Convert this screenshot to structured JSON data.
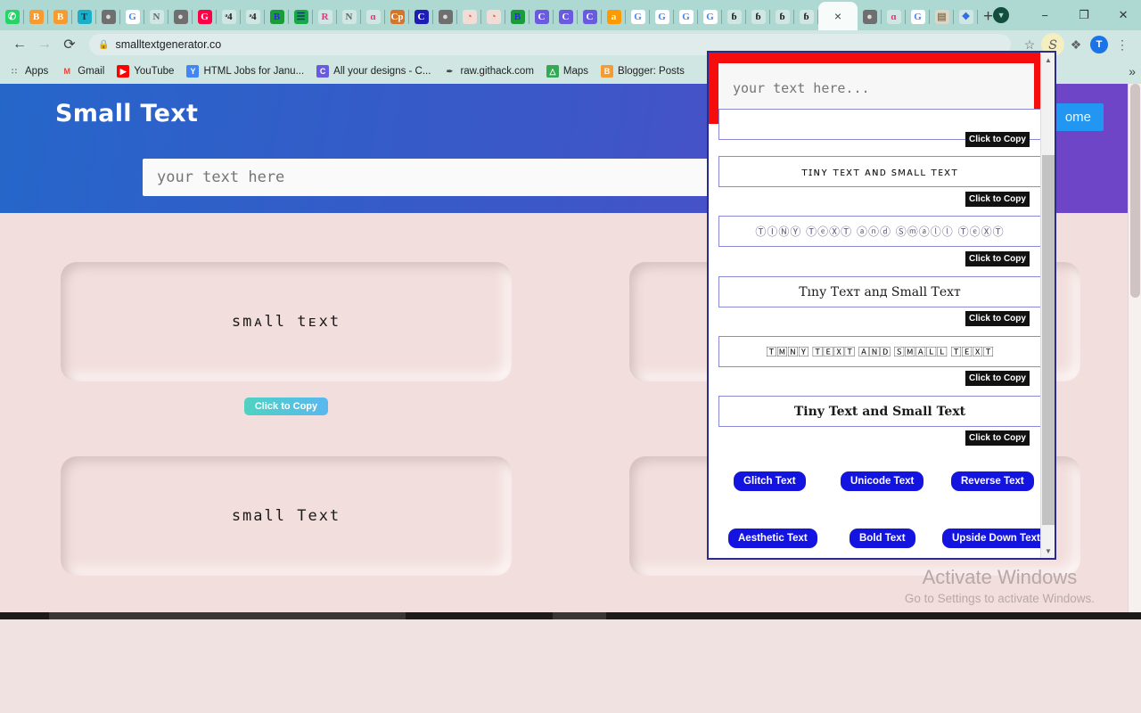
{
  "browser": {
    "tabs": [
      {
        "name": "whatsapp-tab",
        "glyph": "✆",
        "bg": "#25d366",
        "fg": "#ffffff"
      },
      {
        "name": "blogger-tab-1",
        "glyph": "B",
        "bg": "#f59b31",
        "fg": "#ffffff"
      },
      {
        "name": "blogger-tab-2",
        "glyph": "B",
        "bg": "#f59b31",
        "fg": "#ffffff"
      },
      {
        "name": "tool-tab-1",
        "glyph": "T",
        "bg": "#1cb0c8",
        "fg": "#14324a"
      },
      {
        "name": "globe-tab-1",
        "glyph": "●",
        "bg": "#6f6f6f",
        "fg": "#d9d9d9"
      },
      {
        "name": "google-tab-1",
        "glyph": "G",
        "bg": "#ffffff",
        "fg": "#4285f4"
      },
      {
        "name": "news-tab-1",
        "glyph": "N",
        "bg": "#cfe6e2",
        "fg": "#5a6a6a"
      },
      {
        "name": "globe-tab-2",
        "glyph": "●",
        "bg": "#6f6f6f",
        "fg": "#d9d9d9"
      },
      {
        "name": "generator-tab-1",
        "glyph": "G",
        "bg": "#ff0044",
        "fg": "#ffffff"
      },
      {
        "name": "unicode-tab-1",
        "glyph": "ᵊ4",
        "bg": "#cfe6e2",
        "fg": "#1a1a1a"
      },
      {
        "name": "unicode-tab-2",
        "glyph": "ᵊ4",
        "bg": "#cfe6e2",
        "fg": "#1a1a1a"
      },
      {
        "name": "blue-tab-1",
        "glyph": "B",
        "bg": "#1b9b3a",
        "fg": "#2b2be0"
      },
      {
        "name": "green-tab-1",
        "glyph": "☰",
        "bg": "#17a84a",
        "fg": "#123a6a"
      },
      {
        "name": "r-tab-1",
        "glyph": "R",
        "bg": "#cfe6e2",
        "fg": "#e0357a"
      },
      {
        "name": "news-tab-2",
        "glyph": "N",
        "bg": "#cfe6e2",
        "fg": "#5a6a6a"
      },
      {
        "name": "script-tab-1",
        "glyph": "ɑ",
        "bg": "#cfe6e2",
        "fg": "#e0357a"
      },
      {
        "name": "copy-tab-1",
        "glyph": "Cp",
        "bg": "#d2762e",
        "fg": "#ffffff"
      },
      {
        "name": "c-tab-1",
        "glyph": "C",
        "bg": "#1e1eb4",
        "fg": "#ffffff"
      },
      {
        "name": "globe-tab-3",
        "glyph": "●",
        "bg": "#6f6f6f",
        "fg": "#d9d9d9"
      },
      {
        "name": "pink-tab-1",
        "glyph": "◔",
        "bg": "#f0ddd8",
        "fg": "#e05a3a"
      },
      {
        "name": "pink-tab-2",
        "glyph": "◔",
        "bg": "#f0ddd8",
        "fg": "#e05a3a"
      },
      {
        "name": "blue-tab-2",
        "glyph": "B",
        "bg": "#1b9b3a",
        "fg": "#2b2be0"
      },
      {
        "name": "canva-tab-1",
        "glyph": "C",
        "bg": "#6a5ae0",
        "fg": "#ffffff"
      },
      {
        "name": "canva-tab-2",
        "glyph": "C",
        "bg": "#6a5ae0",
        "fg": "#ffffff"
      },
      {
        "name": "canva-tab-3",
        "glyph": "C",
        "bg": "#6a5ae0",
        "fg": "#ffffff"
      },
      {
        "name": "amazon-tab-1",
        "glyph": "a",
        "bg": "#ff9900",
        "fg": "#ffffff"
      },
      {
        "name": "google-tab-2",
        "glyph": "G",
        "bg": "#ffffff",
        "fg": "#4285f4"
      },
      {
        "name": "google-tab-3",
        "glyph": "G",
        "bg": "#ffffff",
        "fg": "#4285f4"
      },
      {
        "name": "google-tab-4",
        "glyph": "G",
        "bg": "#ffffff",
        "fg": "#4285f4"
      },
      {
        "name": "google-tab-5",
        "glyph": "G",
        "bg": "#ffffff",
        "fg": "#4285f4"
      },
      {
        "name": "blogger-tab-3",
        "glyph": "ɓ",
        "bg": "#cfe6e2",
        "fg": "#111111"
      },
      {
        "name": "blogger-tab-4",
        "glyph": "ɓ",
        "bg": "#cfe6e2",
        "fg": "#111111"
      },
      {
        "name": "blogger-tab-5",
        "glyph": "ɓ",
        "bg": "#cfe6e2",
        "fg": "#111111"
      },
      {
        "name": "blogger-tab-6",
        "glyph": "ɓ",
        "bg": "#cfe6e2",
        "fg": "#111111"
      }
    ],
    "active_tab": {
      "name": "smalltextgenerator-tab",
      "close_glyph": "×"
    },
    "tabs_after_active": [
      {
        "name": "globe-tab-4",
        "glyph": "●",
        "bg": "#6f6f6f",
        "fg": "#d9d9d9"
      },
      {
        "name": "script-tab-2",
        "glyph": "ɑ",
        "bg": "#cfe6e2",
        "fg": "#e0357a"
      },
      {
        "name": "google-tab-6",
        "glyph": "G",
        "bg": "#ffffff",
        "fg": "#4285f4"
      },
      {
        "name": "image-tab-1",
        "glyph": "▤",
        "bg": "#ddd6c6",
        "fg": "#8a7a5a"
      },
      {
        "name": "extensions-tab-1",
        "glyph": "❖",
        "bg": "#cfe6e2",
        "fg": "#2b6fe0"
      }
    ],
    "newtab_label": "+",
    "window_controls": {
      "shield": "▼",
      "minimize": "−",
      "maximize": "❐",
      "close": "✕"
    },
    "toolbar": {
      "back": "←",
      "forward": "→",
      "reload": "⟳",
      "lock_icon": "🔒",
      "url": "smalltextgenerator.co",
      "bookmark_star": "☆",
      "extension_active": "𝑆",
      "puzzle_icon": "❖",
      "profile_initial": "T",
      "menu_dots": "⋮"
    },
    "bookmarks": [
      {
        "name": "apps",
        "label": "Apps",
        "glyph": "∷",
        "bg": "#cfe6e2",
        "fg": "#5f6368"
      },
      {
        "name": "gmail",
        "label": "Gmail",
        "glyph": "M",
        "bg": "#cfe6e2",
        "fg": "#ea4335"
      },
      {
        "name": "youtube",
        "label": "YouTube",
        "glyph": "▶",
        "bg": "#ff0000",
        "fg": "#ffffff"
      },
      {
        "name": "html-jobs",
        "label": "HTML Jobs for Janu...",
        "glyph": "Y",
        "bg": "#4285f4",
        "fg": "#ffffff"
      },
      {
        "name": "all-your-designs",
        "label": "All your designs - C...",
        "glyph": "C",
        "bg": "#6a5ae0",
        "fg": "#ffffff"
      },
      {
        "name": "raw-githack",
        "label": "raw.githack.com",
        "glyph": "✒",
        "bg": "#cfe6e2",
        "fg": "#444444"
      },
      {
        "name": "maps",
        "label": "Maps",
        "glyph": "△",
        "bg": "#34a853",
        "fg": "#ffffff"
      },
      {
        "name": "blogger-posts",
        "label": "Blogger: Posts",
        "glyph": "B",
        "bg": "#f59b31",
        "fg": "#ffffff"
      }
    ],
    "bookmarks_overflow": "»"
  },
  "site": {
    "title": "Small Text",
    "home_label": "ome",
    "hero_placeholder": "your text here",
    "cards": [
      {
        "name": "result-card-small-text-1",
        "text": "smᴀll  tᴇxt",
        "copy_label": "Click to Copy"
      },
      {
        "name": "result-card-small-text-2",
        "text": "small  Text",
        "copy_label": ""
      }
    ],
    "watermark": {
      "line1": "Activate Windows",
      "line2": "Go to Settings to activate Windows."
    }
  },
  "popup": {
    "input_placeholder": "your text here...",
    "copy_label": "Click to Copy",
    "variants": [
      {
        "name": "variant-circled-filled",
        "text": "ᴛɪɴʏ ᴛᴇxᴛ ᴀɴᴅ sᴍᴀʟʟ ᴛᴇxᴛ",
        "style": "v-circled"
      },
      {
        "name": "variant-circled-outline",
        "text": "ⓉⒾⓃⓎ ⓉⓔⓍⓉ ⓐⓝⓓ Ⓢⓜⓐⓛⓛ ⓉⓔⓍⓉ",
        "style": "v-circled-out"
      },
      {
        "name": "variant-fraktur",
        "text": "Tınу Tехт аnд Smаll Tехт",
        "style": "v-fraktur"
      },
      {
        "name": "variant-squared",
        "text": "🅃🄼🄽🅈 🅃🄴🅇🅃 🄰🄽🄳 🅂🄼🄰🄻🄻 🅃🄴🅇🅃",
        "style": "v-squared"
      },
      {
        "name": "variant-serif-bold",
        "text": "Tiny Text and Small Text",
        "style": "v-serif-bold"
      }
    ],
    "buttons_row1": [
      {
        "name": "glitch-text-button",
        "label": "Glitch Text"
      },
      {
        "name": "unicode-text-button",
        "label": "Unicode Text"
      },
      {
        "name": "reverse-text-button",
        "label": "Reverse Text"
      }
    ],
    "buttons_row2": [
      {
        "name": "aesthetic-text-button",
        "label": "Aesthetic Text"
      },
      {
        "name": "bold-text-button",
        "label": "Bold Text"
      },
      {
        "name": "upside-down-text-button",
        "label": "Upside Down Text"
      }
    ],
    "scroll_up": "▲",
    "scroll_down": "▼"
  }
}
